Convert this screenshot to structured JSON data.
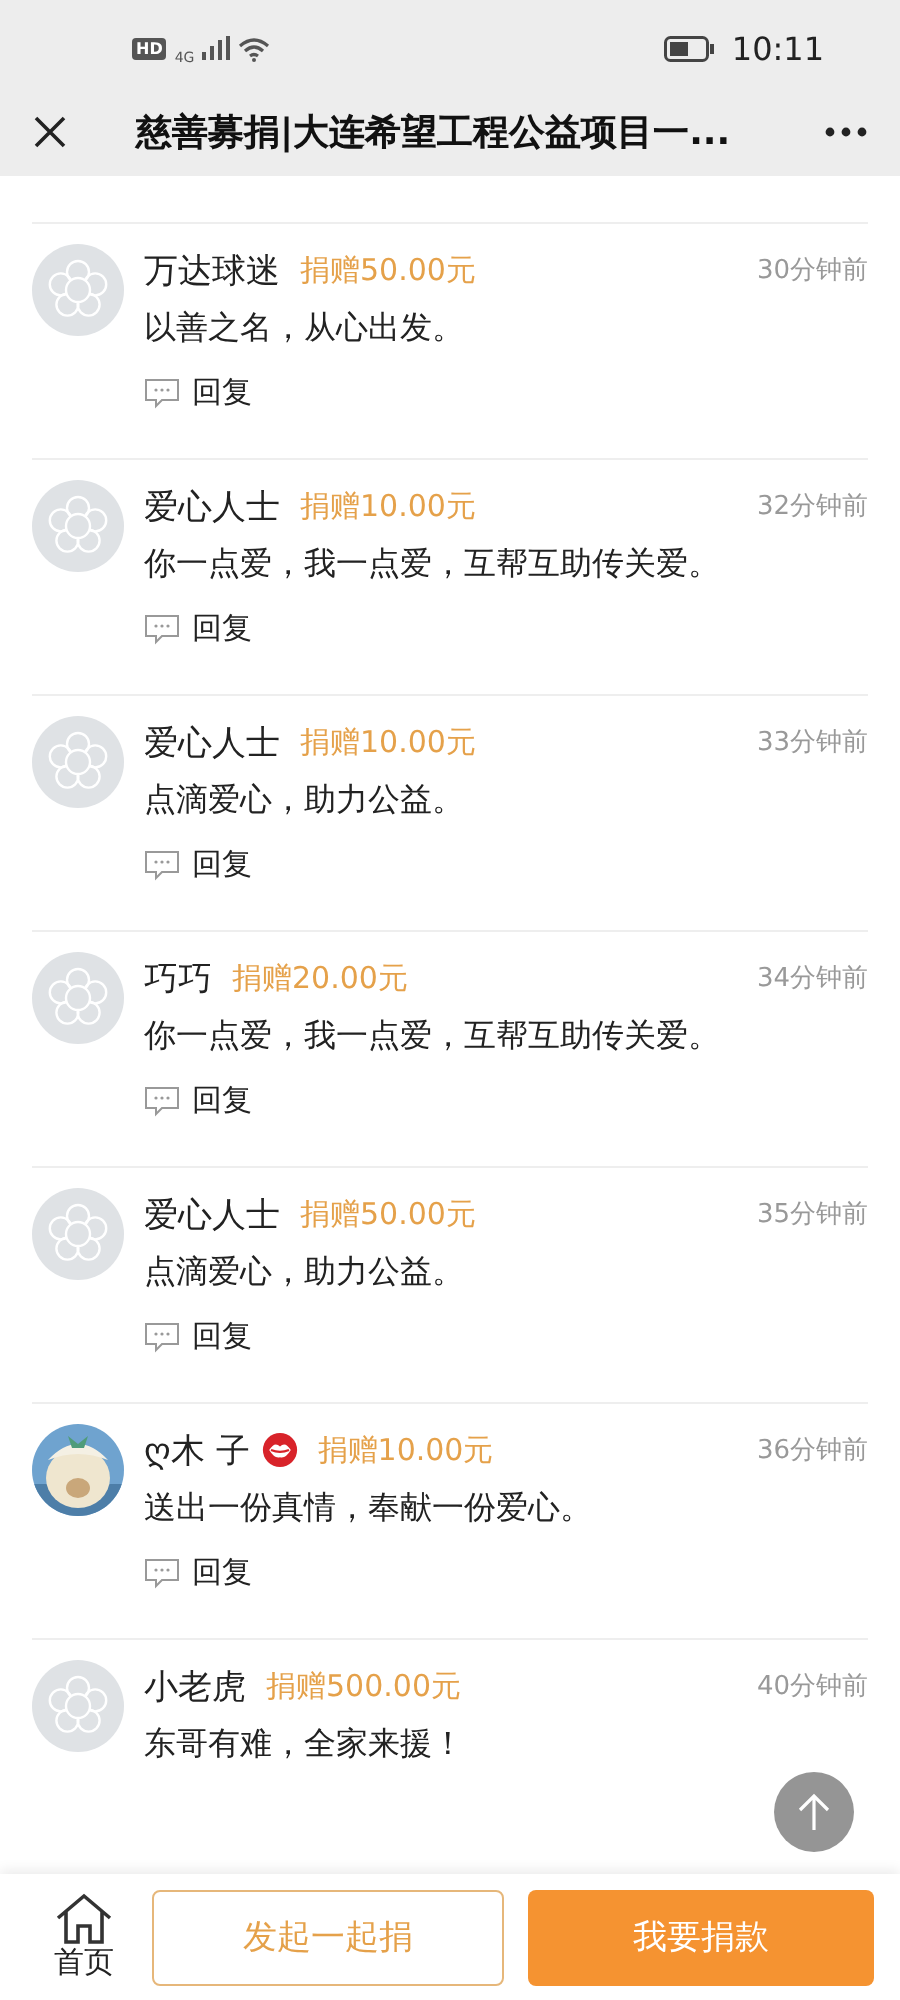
{
  "status_bar": {
    "hd": "HD",
    "network": "4G",
    "time": "10:11"
  },
  "nav": {
    "title": "慈善募捐|大连希望工程公益项目一..."
  },
  "comments": [
    {
      "avatar": {
        "kind": "default"
      },
      "name": "万达球迷",
      "lips": false,
      "amount": "捐赠50.00元",
      "time": "30分钟前",
      "text": "以善之名，从心出发。",
      "reply": "回复"
    },
    {
      "avatar": {
        "kind": "default"
      },
      "name": "爱心人士",
      "lips": false,
      "amount": "捐赠10.00元",
      "time": "32分钟前",
      "text": "你一点爱，我一点爱，互帮互助传关爱。",
      "reply": "回复"
    },
    {
      "avatar": {
        "kind": "default"
      },
      "name": "爱心人士",
      "lips": false,
      "amount": "捐赠10.00元",
      "time": "33分钟前",
      "text": "点滴爱心，助力公益。",
      "reply": "回复"
    },
    {
      "avatar": {
        "kind": "default"
      },
      "name": "巧巧",
      "lips": false,
      "amount": "捐赠20.00元",
      "time": "34分钟前",
      "text": "你一点爱，我一点爱，互帮互助传关爱。",
      "reply": "回复"
    },
    {
      "avatar": {
        "kind": "default"
      },
      "name": "爱心人士",
      "lips": false,
      "amount": "捐赠50.00元",
      "time": "35分钟前",
      "text": "点滴爱心，助力公益。",
      "reply": "回复"
    },
    {
      "name": "ღ木 子",
      "lips": true,
      "amount": "捐赠10.00元",
      "time": "36分钟前",
      "text": "送出一份真情，奉献一份爱心。",
      "reply": "回复"
    },
    {
      "avatar": {
        "kind": "default"
      },
      "name": "小老虎",
      "lips": false,
      "amount": "捐赠500.00元",
      "time": "40分钟前",
      "text": "东哥有难，全家来援！"
    }
  ],
  "bottom_bar": {
    "home": "首页",
    "start": "发起一起捐",
    "donate": "我要捐款"
  }
}
